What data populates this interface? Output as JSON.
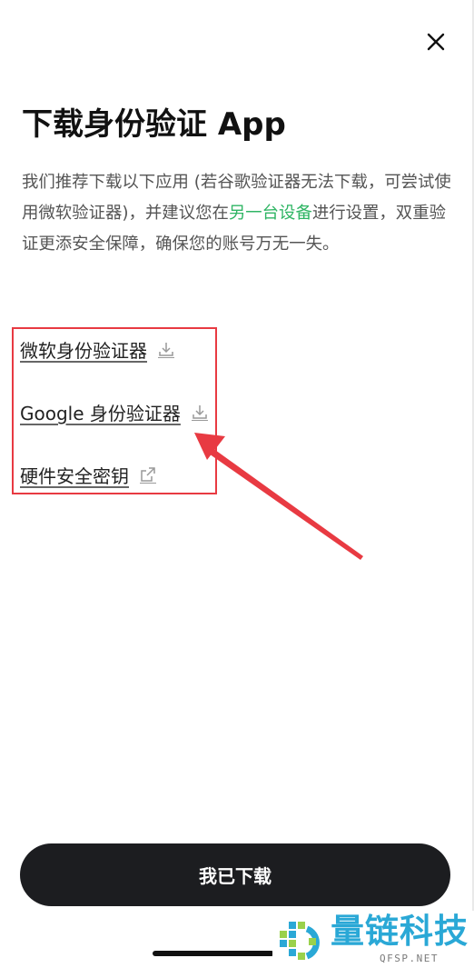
{
  "header": {
    "close_icon": "close-icon",
    "title": "下载身份验证 App"
  },
  "description": {
    "part1": "我们推荐下载以下应用 (若谷歌验证器无法下载，可尝试使用微软验证器)，并建议您在",
    "link": "另一台设备",
    "part2": "进行设置，双重验证更添安全保障，确保您的账号万无一失。",
    "link_color": "#2fb564"
  },
  "apps": [
    {
      "label": "微软身份验证器",
      "icon": "download-icon"
    },
    {
      "label": "Google 身份验证器",
      "icon": "download-icon"
    },
    {
      "label": "硬件安全密钥",
      "icon": "external-link-icon"
    }
  ],
  "primary_button": {
    "label": "我已下载",
    "color": "#1c1d20"
  },
  "annotation": {
    "color": "#e83a42"
  },
  "watermark": {
    "name": "量链科技",
    "domain": "QFSP.NET"
  }
}
